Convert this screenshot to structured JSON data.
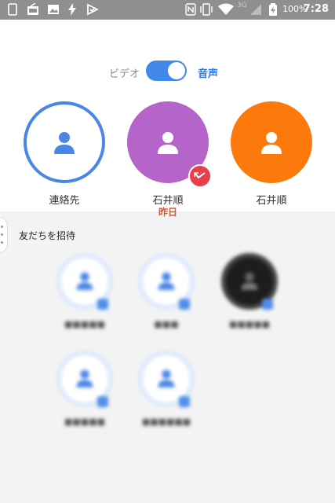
{
  "statusbar": {
    "network": "3G",
    "battery": "100%",
    "time": "7:28"
  },
  "toggle": {
    "video_label": "ビデオ",
    "audio_label": "音声",
    "selected": "音声"
  },
  "contacts": [
    {
      "name": "連絡先",
      "sub": "",
      "color": "#ffffff",
      "ring": "#4a86e8"
    },
    {
      "name": "石井順",
      "sub": "昨日",
      "color": "#b565c9",
      "ring": ""
    },
    {
      "name": "石井順",
      "sub": "",
      "color": "#fc7a0b",
      "ring": ""
    }
  ],
  "invite": {
    "title": "友だちを招待",
    "people": [
      {
        "name": "■■■■■"
      },
      {
        "name": "■■■"
      },
      {
        "name": "■■■■■"
      },
      {
        "name": "■■■■■"
      },
      {
        "name": "■■■■■■"
      }
    ]
  },
  "colors": {
    "accent": "#2d7be5",
    "missed": "#e8404a"
  }
}
